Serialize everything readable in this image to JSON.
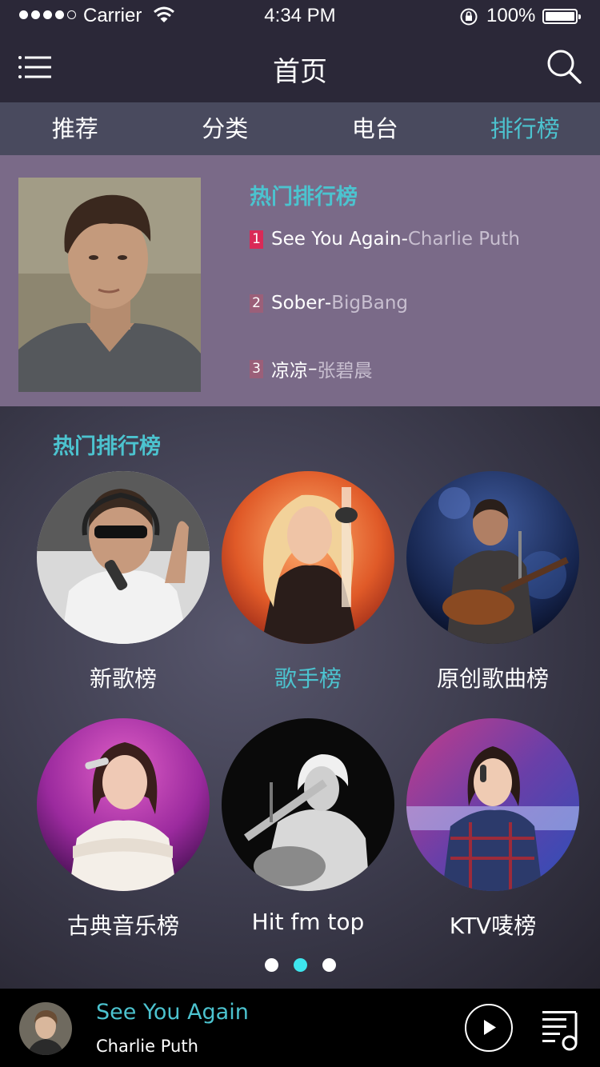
{
  "status_bar": {
    "carrier": "Carrier",
    "time": "4:34 PM",
    "battery": "100%",
    "signal_icon": "signal-dots-icon",
    "wifi_icon": "wifi-icon",
    "lock_icon": "rotation-lock-icon",
    "battery_icon": "battery-icon"
  },
  "nav": {
    "title": "首页",
    "menu_icon": "menu-icon",
    "search_icon": "search-icon"
  },
  "tabs": [
    {
      "label": "推荐",
      "active": false
    },
    {
      "label": "分类",
      "active": false
    },
    {
      "label": "电台",
      "active": false
    },
    {
      "label": "排行榜",
      "active": true
    }
  ],
  "hot_chart": {
    "title": "热门排行榜",
    "items": [
      {
        "rank": "1",
        "song": "See You Again",
        "separator": "-",
        "artist": "Charlie Puth"
      },
      {
        "rank": "2",
        "song": "Sober",
        "separator": "-",
        "artist": "BigBang"
      },
      {
        "rank": "3",
        "song": "凉凉",
        "separator": "–",
        "artist": "张碧晨"
      }
    ]
  },
  "charts_section": {
    "title": "热门排行榜",
    "cards": [
      {
        "label": "新歌榜",
        "active": false
      },
      {
        "label": "歌手榜",
        "active": true
      },
      {
        "label": "原创歌曲榜",
        "active": false
      },
      {
        "label": "古典音乐榜",
        "active": false
      },
      {
        "label": "Hit fm top",
        "active": false
      },
      {
        "label": "KTV唛榜",
        "active": false
      }
    ],
    "pager": {
      "pages": 3,
      "current": 2
    }
  },
  "player": {
    "song": "See You Again",
    "artist": "Charlie Puth",
    "play_icon": "play-icon",
    "playlist_icon": "playlist-icon"
  },
  "colors": {
    "accent": "#4cc3cf",
    "header_bg": "#2b2838",
    "tab_bg": "#494a5e",
    "hot_panel_bg": "#7a6a88",
    "rank_1": "#d92a57",
    "rank_other": "#9b5f79",
    "pager_active": "#3ee6ee",
    "player_bg": "#000000"
  }
}
